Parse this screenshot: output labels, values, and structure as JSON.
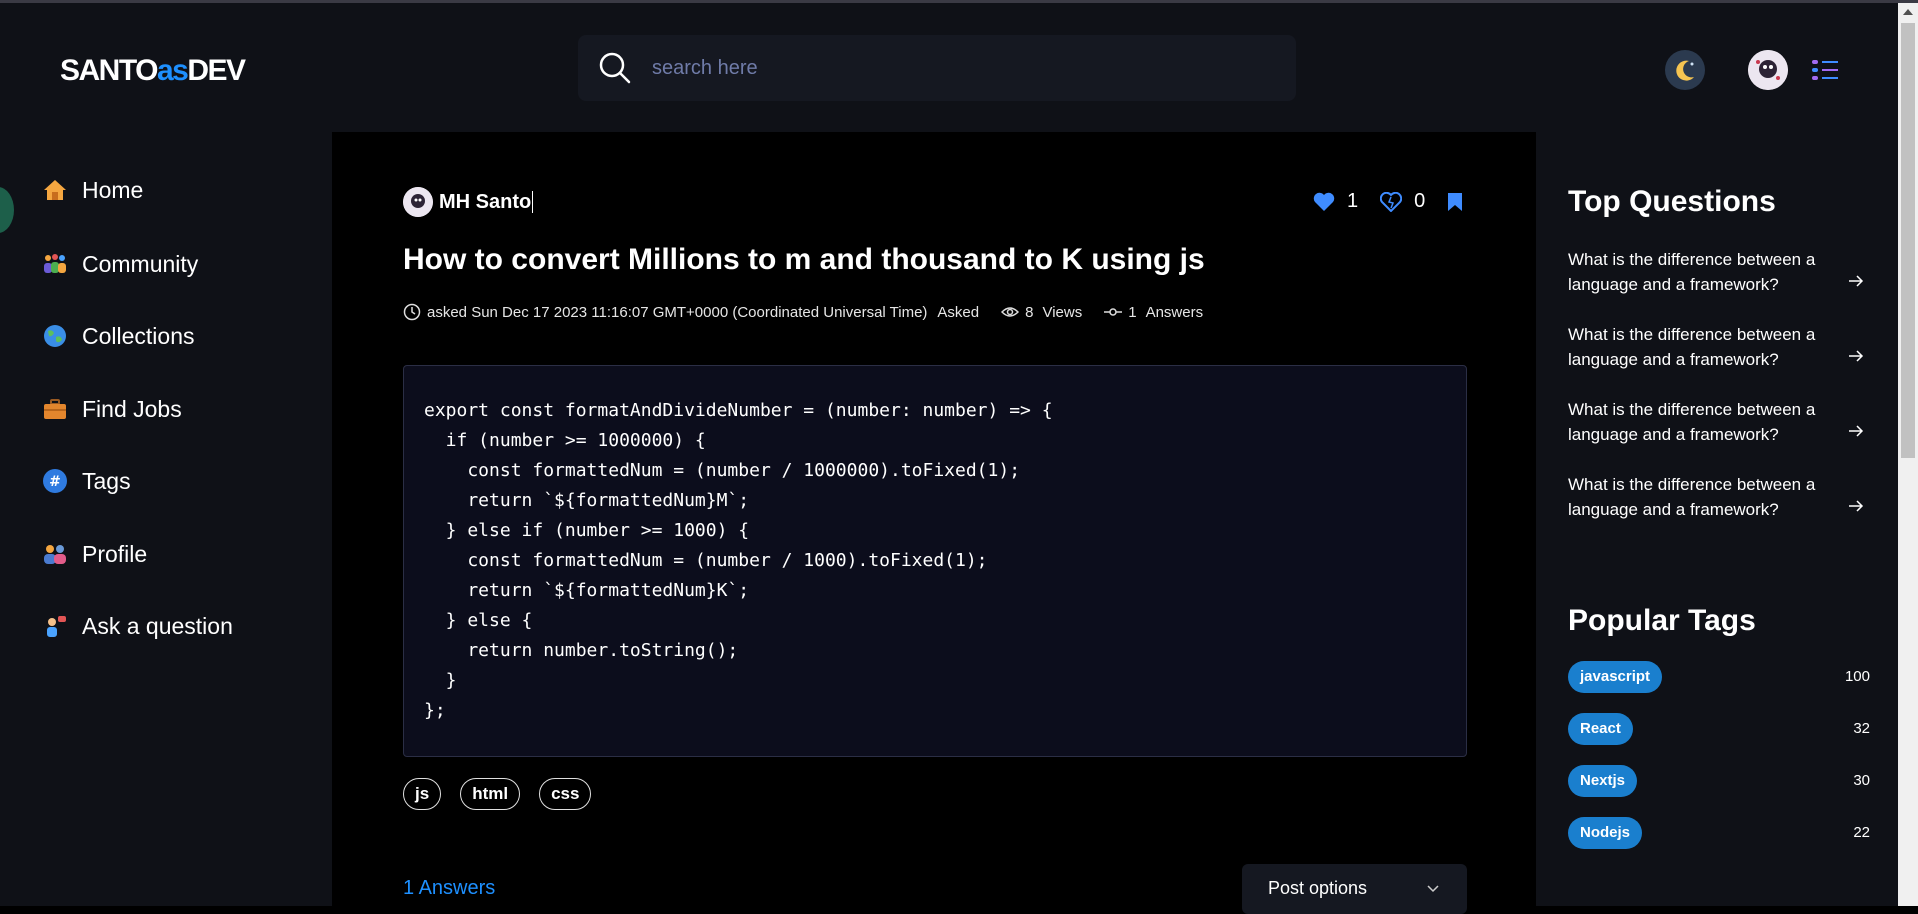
{
  "header": {
    "logo_part1": "SANTO",
    "logo_part2": "as",
    "logo_part3": "DEV",
    "search_placeholder": "search here"
  },
  "sidebar": {
    "items": [
      {
        "label": "Home",
        "icon": "home-icon"
      },
      {
        "label": "Community",
        "icon": "community-icon"
      },
      {
        "label": "Collections",
        "icon": "globe-icon"
      },
      {
        "label": "Find Jobs",
        "icon": "briefcase-icon"
      },
      {
        "label": "Tags",
        "icon": "hashtag-icon"
      },
      {
        "label": "Profile",
        "icon": "users-icon"
      },
      {
        "label": "Ask a question",
        "icon": "ask-icon"
      }
    ]
  },
  "question": {
    "author": "MH Santo",
    "upvotes": "1",
    "downvotes": "0",
    "title": "How to convert Millions to m and thousand to K using js",
    "asked": "asked Sun Dec 17 2023 11:16:07 GMT+0000 (Coordinated Universal Time)",
    "asked_label": "Asked",
    "views_count": "8",
    "views_label": "Views",
    "answers_count": "1",
    "answers_label": "Answers",
    "code": "export const formatAndDivideNumber = (number: number) => {\n  if (number >= 1000000) {\n    const formattedNum = (number / 1000000).toFixed(1);\n    return `${formattedNum}M`;\n  } else if (number >= 1000) {\n    const formattedNum = (number / 1000).toFixed(1);\n    return `${formattedNum}K`;\n  } else {\n    return number.toString();\n  }\n};",
    "tags": [
      "js",
      "html",
      "css"
    ],
    "answers_heading": "1 Answers",
    "post_options_label": "Post options"
  },
  "right": {
    "top_questions_title": "Top Questions",
    "top_questions": [
      "What is the difference between a language and a framework?",
      "What is the difference between a language and a framework?",
      "What is the difference between a language and a framework?",
      "What is the difference between a language and a framework?"
    ],
    "popular_tags_title": "Popular Tags",
    "popular_tags": [
      {
        "name": "javascript",
        "count": "100"
      },
      {
        "name": "React",
        "count": "32"
      },
      {
        "name": "Nextjs",
        "count": "30"
      },
      {
        "name": "Nodejs",
        "count": "22"
      }
    ]
  },
  "colors": {
    "accent": "#1e90ff",
    "tag_badge": "#1a7fce",
    "panel": "#0f1117"
  }
}
